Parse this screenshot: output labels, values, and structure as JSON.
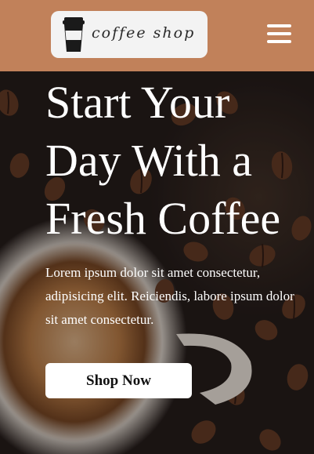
{
  "header": {
    "logo_text": "coffee shop",
    "cup_icon": "coffee-cup-icon",
    "menu_icon": "hamburger-menu-icon",
    "bg_color": "#c1815a"
  },
  "hero": {
    "title": "Start Your Day With a Fresh Coffee",
    "description": "Lorem ipsum dolor sit amet consectetur, adipisicing elit. Reiciendis, labore ipsum dolor sit amet consectetur.",
    "button_label": "Shop Now"
  }
}
